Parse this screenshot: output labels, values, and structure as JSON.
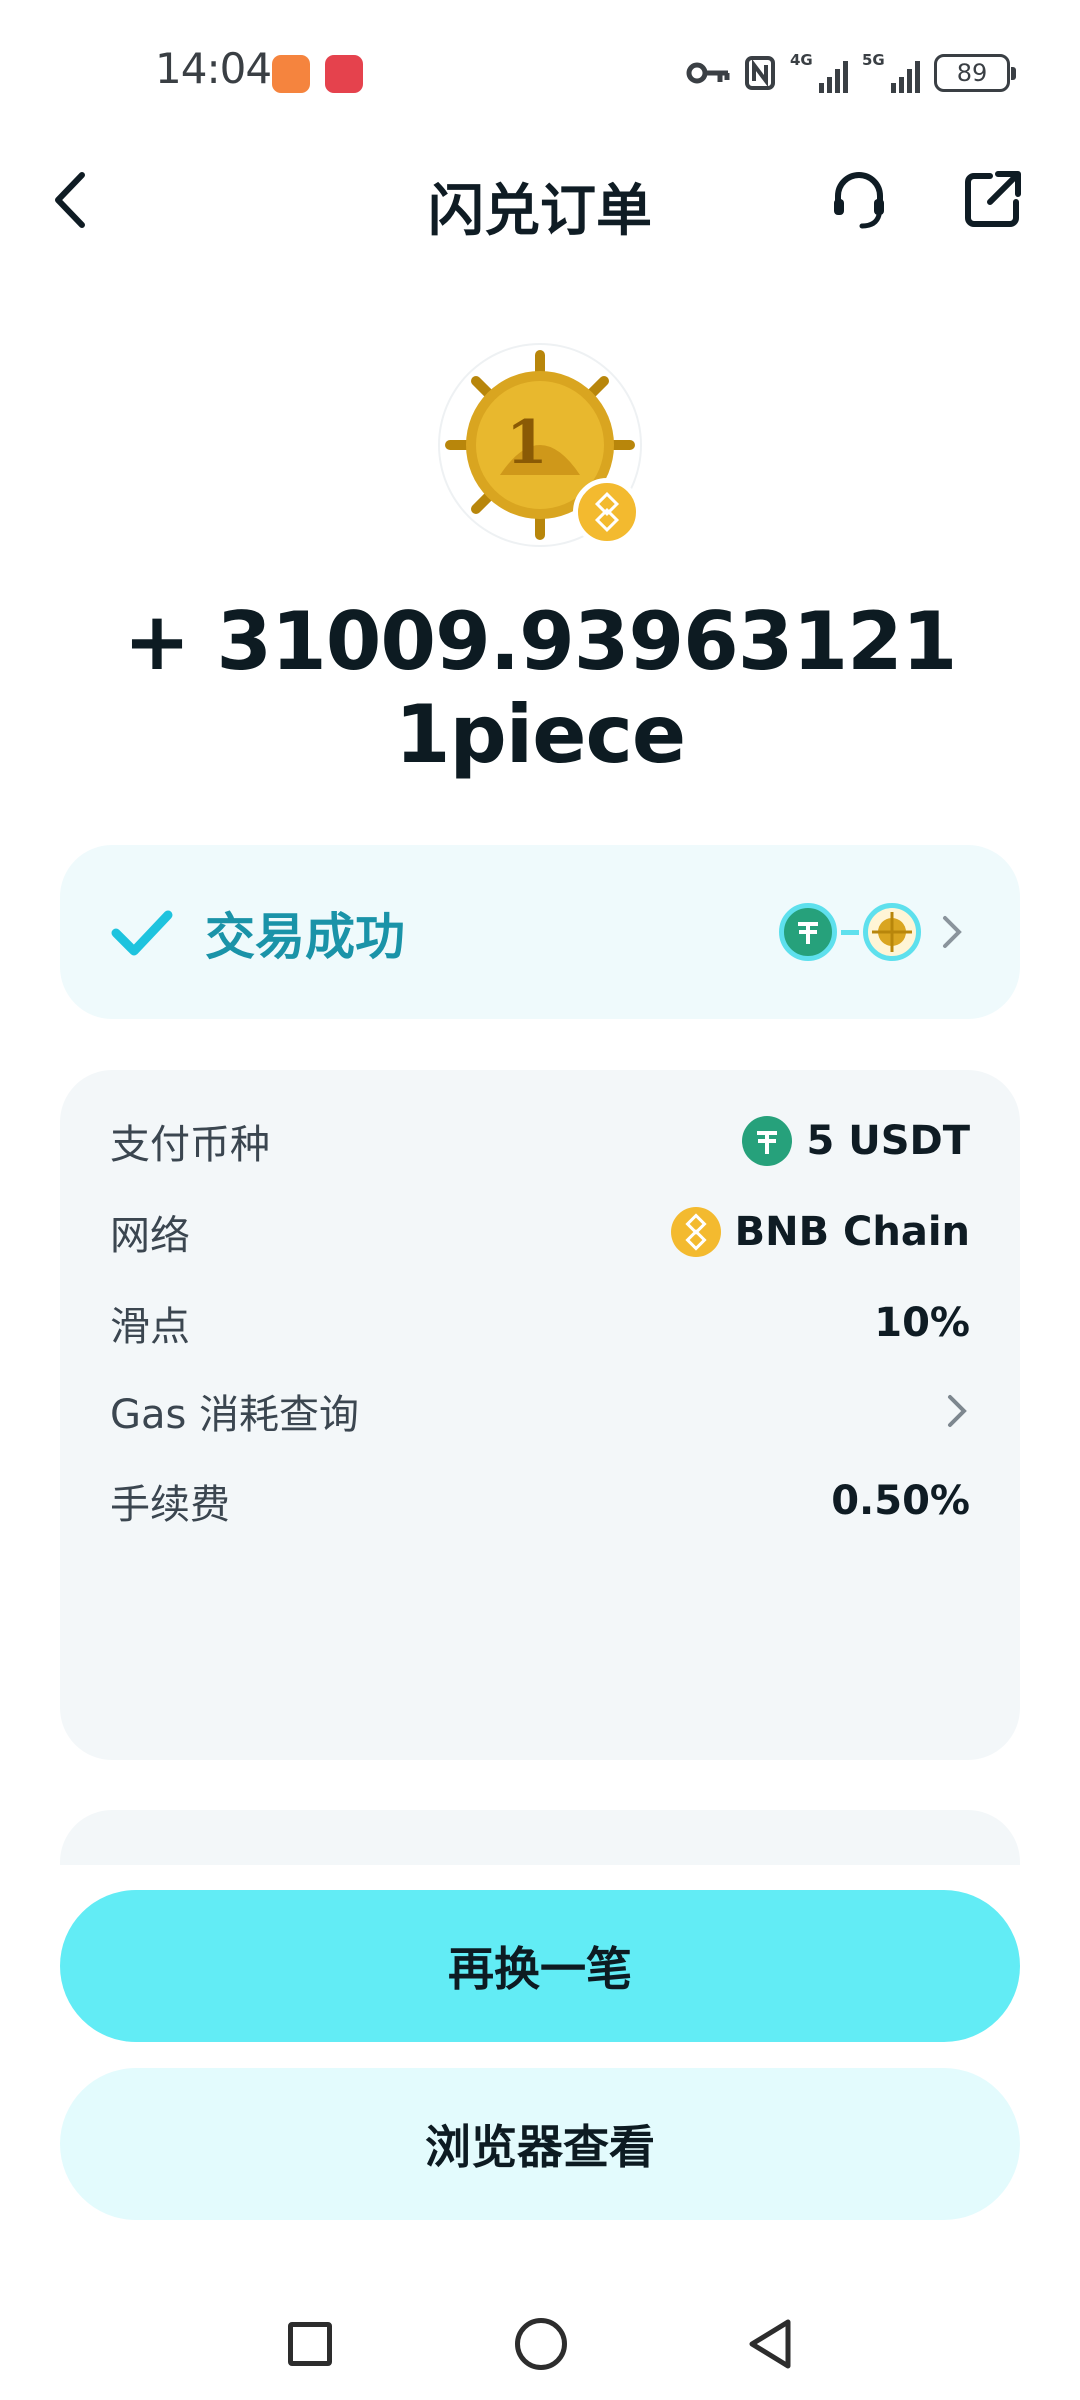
{
  "status_bar": {
    "time": "14:04",
    "network_1": "4G",
    "network_2": "5G",
    "battery": "89"
  },
  "header": {
    "title": "闪兑订单"
  },
  "token": {
    "icon": "onepiece-coin-icon",
    "chain_badge_icon": "bnb-badge-icon"
  },
  "amount": "+ 31009.93963121 1piece",
  "status": {
    "text": "交易成功",
    "route_from_icon": "usdt-icon",
    "route_to_icon": "onepiece-coin-icon"
  },
  "details": [
    {
      "label": "支付币种",
      "value": "5 USDT",
      "icon": "usdt-icon"
    },
    {
      "label": "网络",
      "value": "BNB Chain",
      "icon": "bnb-icon"
    },
    {
      "label": "滑点",
      "value": "10%"
    },
    {
      "label": "Gas 消耗查询",
      "value": "",
      "icon": "chevron-right-icon"
    },
    {
      "label": "手续费",
      "value": "0.50%"
    }
  ],
  "actions": {
    "primary": "再换一笔",
    "secondary": "浏览器查看"
  },
  "colors": {
    "accent": "#62ecf5",
    "success_text": "#1a93a8",
    "usdt": "#26a17b",
    "bnb": "#f3ba2f"
  }
}
